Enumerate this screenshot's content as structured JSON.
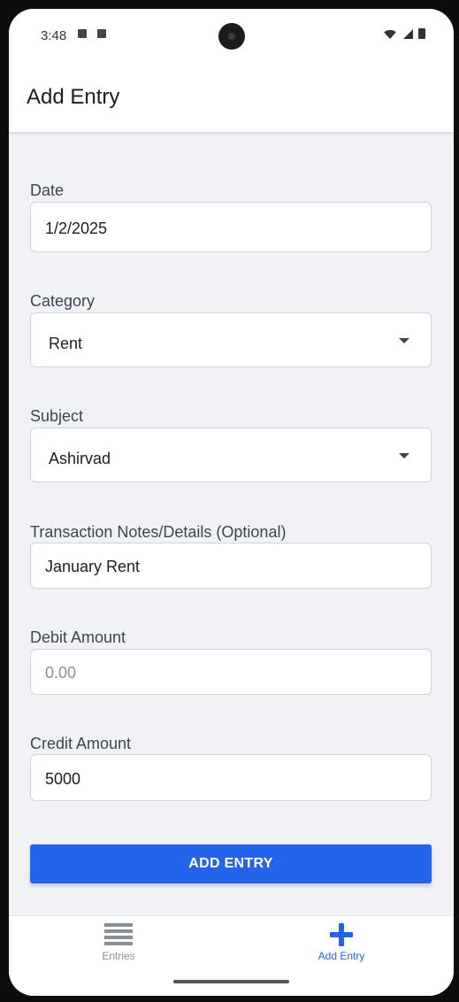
{
  "status_bar": {
    "time": "3:48",
    "icons": [
      "sd-card-icon",
      "notification-icon",
      "wifi-icon",
      "signal-icon",
      "battery-icon"
    ]
  },
  "app_bar": {
    "title": "Add Entry"
  },
  "form": {
    "date": {
      "label": "Date",
      "value": "1/2/2025"
    },
    "category": {
      "label": "Category",
      "value": "Rent"
    },
    "subject": {
      "label": "Subject",
      "value": "Ashirvad"
    },
    "notes": {
      "label": "Transaction Notes/Details (Optional)",
      "value": "January Rent"
    },
    "debit": {
      "label": "Debit Amount",
      "placeholder": "0.00",
      "value": ""
    },
    "credit": {
      "label": "Credit Amount",
      "value": "5000"
    },
    "submit_label": "ADD ENTRY"
  },
  "bottom_nav": {
    "items": [
      {
        "label": "Entries",
        "icon": "list-icon",
        "active": false
      },
      {
        "label": "Add Entry",
        "icon": "plus-icon",
        "active": true
      }
    ]
  },
  "colors": {
    "accent": "#2563eb",
    "background": "#f0f2f5",
    "inactive": "#8a8f96"
  }
}
